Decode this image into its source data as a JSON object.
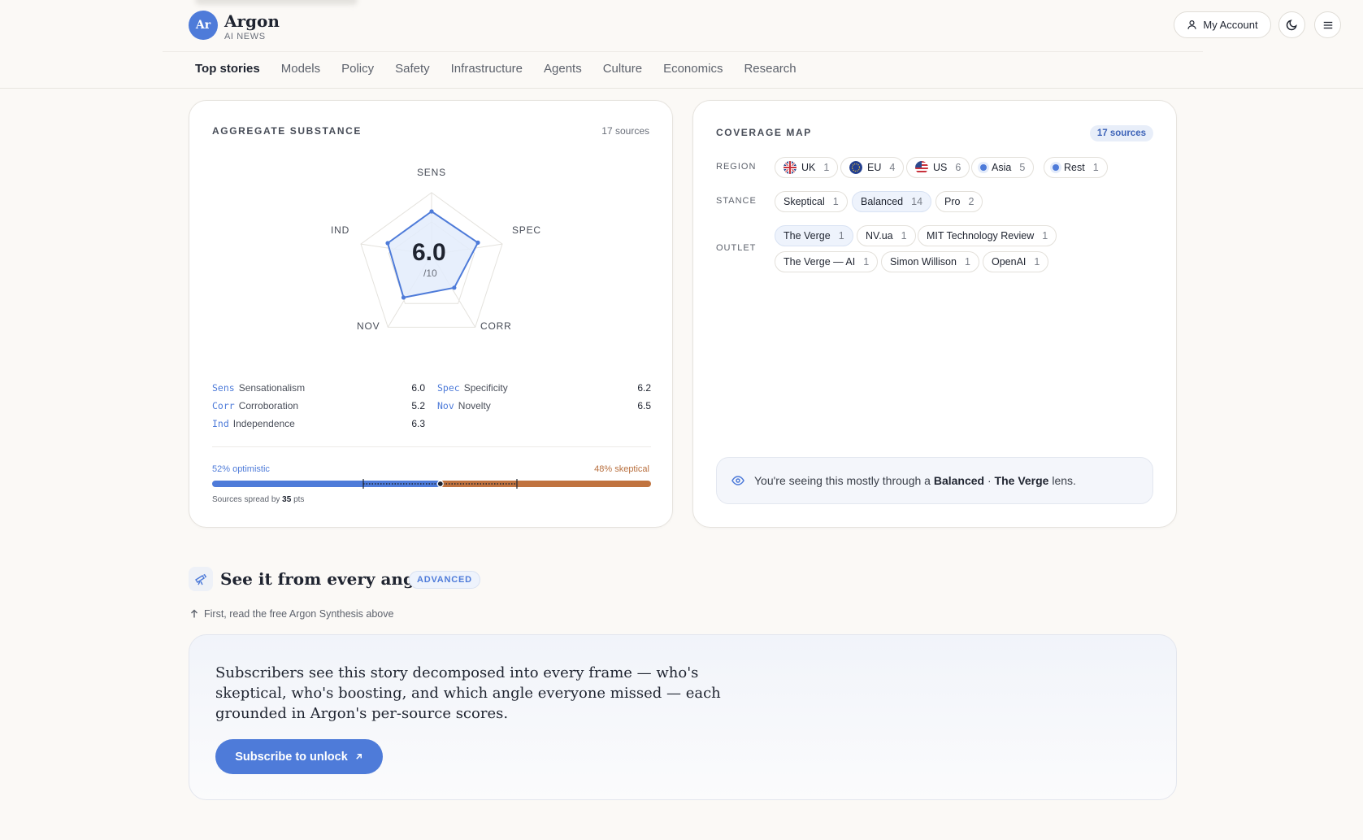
{
  "brand": {
    "logo_text": "Ar",
    "name": "Argon",
    "sub": "AI NEWS"
  },
  "header": {
    "account_label": "My Account"
  },
  "nav": [
    "Top stories",
    "Models",
    "Policy",
    "Safety",
    "Infrastructure",
    "Agents",
    "Culture",
    "Economics",
    "Research"
  ],
  "substance": {
    "title": "AGGREGATE SUBSTANCE",
    "sources": "17 sources",
    "score": "6.0",
    "score_den": "/10",
    "axes": {
      "sens": "SENS",
      "spec": "SPEC",
      "corr": "CORR",
      "nov": "NOV",
      "ind": "IND"
    },
    "metrics": [
      {
        "code": "Sens",
        "label": "Sensationalism",
        "value": "6.0"
      },
      {
        "code": "Spec",
        "label": "Specificity",
        "value": "6.2"
      },
      {
        "code": "Corr",
        "label": "Corroboration",
        "value": "5.2"
      },
      {
        "code": "Nov",
        "label": "Novelty",
        "value": "6.5"
      },
      {
        "code": "Ind",
        "label": "Independence",
        "value": "6.3"
      }
    ],
    "optimistic_label": "52% optimistic",
    "skeptical_label": "48% skeptical",
    "optimistic_fraction": 0.52,
    "spread_prefix": "Sources spread by",
    "spread_value": "35",
    "spread_suffix": "pts"
  },
  "coverage": {
    "title": "COVERAGE MAP",
    "badge": "17 sources",
    "region_label": "REGION",
    "stance_label": "STANCE",
    "outlet_label": "OUTLET",
    "regions": [
      {
        "name": "UK",
        "count": "1"
      },
      {
        "name": "EU",
        "count": "4"
      },
      {
        "name": "US",
        "count": "6"
      },
      {
        "name": "Asia",
        "count": "5"
      },
      {
        "name": "Rest",
        "count": "1"
      }
    ],
    "stances": [
      {
        "name": "Skeptical",
        "count": "1"
      },
      {
        "name": "Balanced",
        "count": "14"
      },
      {
        "name": "Pro",
        "count": "2"
      }
    ],
    "outlets": [
      {
        "name": "The Verge",
        "count": "1"
      },
      {
        "name": "NV.ua",
        "count": "1"
      },
      {
        "name": "MIT Technology Review",
        "count": "1"
      },
      {
        "name": "The Verge — AI",
        "count": "1"
      },
      {
        "name": "Simon Willison",
        "count": "1"
      },
      {
        "name": "OpenAI",
        "count": "1"
      }
    ],
    "lens_prefix": "You're seeing this mostly through a",
    "lens_stance": "Balanced",
    "lens_sep": "·",
    "lens_outlet": "The Verge",
    "lens_suffix": "lens."
  },
  "angle": {
    "title": "See it from every angle",
    "badge": "ADVANCED",
    "note": "First, read the free Argon Synthesis above",
    "body": "Subscribers see this story decomposed into every frame — who's skeptical, who's boosting, and which angle everyone missed — each grounded in Argon's per-source scores.",
    "button": "Subscribe to unlock"
  },
  "colors": {
    "accent": "#4e7bd9",
    "skeptical": "#c0733f"
  }
}
